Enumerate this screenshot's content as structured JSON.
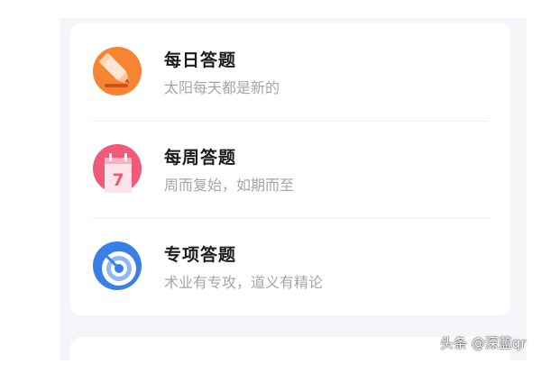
{
  "menu": {
    "items": [
      {
        "title": "每日答题",
        "subtitle": "太阳每天都是新的",
        "icon": "pencil-icon",
        "color": "#f07a2a"
      },
      {
        "title": "每周答题",
        "subtitle": "周而复始，如期而至",
        "icon": "calendar-icon",
        "color": "#ee5a78",
        "icon_text": "7"
      },
      {
        "title": "专项答题",
        "subtitle": "术业有专攻，道义有精论",
        "icon": "target-icon",
        "color": "#3a7fe6"
      }
    ]
  },
  "watermark": "头条 @深蓝qr"
}
